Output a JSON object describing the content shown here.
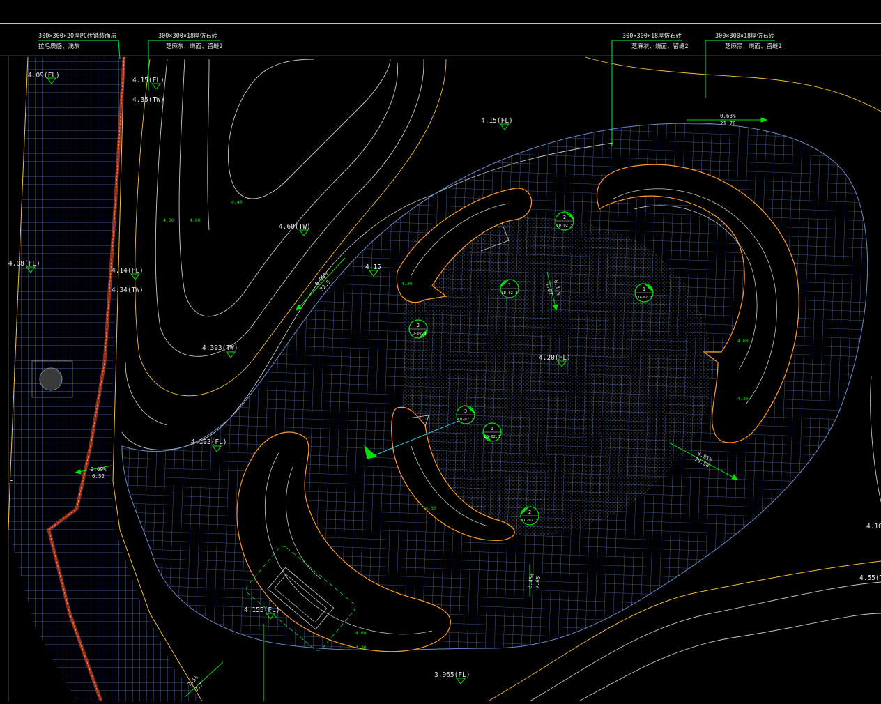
{
  "toolbar": {},
  "colors": {
    "background": "#000000",
    "paving_grid": "#4f6fb8",
    "contour": "#c8c8c8",
    "boundary": "#f0c040",
    "tree_pit": "#ff9a2e",
    "brick_line": "#c0392b",
    "annotation": "#00e000",
    "slope_arrow": "#00e000",
    "leader": "#00cc33",
    "text": "#e6e6e6",
    "contour_label": "#00dd00"
  },
  "callouts": [
    {
      "line1": "300×300×20厚PC砖铺装面层",
      "line2": "拉毛质感、浅灰"
    },
    {
      "line1": "300×300×18厚仿石砖",
      "line2": "芝麻灰、烧面、留缝2"
    },
    {
      "line1": "300×300×18厚仿石砖",
      "line2": "芝麻灰、烧面、留缝2"
    },
    {
      "line1": "300×300×18厚仿石砖",
      "line2": "芝麻黑、烧面、留缝2"
    }
  ],
  "elevations": [
    "4.09(FL)",
    "4.15(FL)",
    "4.35(TW)",
    "4.15(FL)",
    "4.60(TW)",
    "4.15",
    "4.08(FL)",
    "4.14(FL)",
    "4.34(TW)",
    "4.393(TW)",
    "4.20(FL)",
    "4.193(FL)",
    "4.155(FL)",
    "3.965(FL)",
    "4.10",
    "4.55(T"
  ],
  "slopes": [
    {
      "pct": "0.63%",
      "len": "21.70"
    },
    {
      "pct": "0.98%",
      "len": "32.5"
    },
    {
      "pct": "0.17%",
      "len": "1.07"
    },
    {
      "pct": "0.91%",
      "len": "10.58"
    },
    {
      "pct": "2.45%",
      "len": "9.65"
    },
    {
      "pct": "2.09%",
      "len": "6.52"
    },
    {
      "pct": "2.5%",
      "len": "3.7"
    }
  ],
  "contour_labels": [
    "4.40",
    "4.30",
    "4.60",
    "4.30",
    "4.60",
    "4.30",
    "4.30",
    "4.60",
    "4.30"
  ],
  "detail_markers": [
    {
      "num": "2",
      "sheet": "LD-02.3"
    },
    {
      "num": "1",
      "sheet": "LD-02.3"
    },
    {
      "num": "1",
      "sheet": "LD-02.3"
    },
    {
      "num": "2",
      "sheet": "LD-02.3"
    },
    {
      "num": "3",
      "sheet": "LD-02.3"
    },
    {
      "num": "1",
      "sheet": "LD-02.3"
    },
    {
      "num": "2",
      "sheet": "LD-02.3"
    }
  ],
  "edge_mark": "L"
}
